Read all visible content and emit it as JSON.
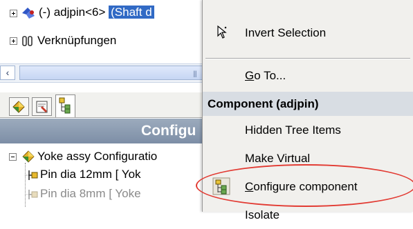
{
  "tree": {
    "top_item": {
      "prefix": "(-) adjpin<6> ",
      "selected_rest": "(Shaft d"
    },
    "verknuepfungen_label": "Verknüpfungen",
    "panel_title": "Configu",
    "config_root_label": "Yoke assy Configuratio",
    "config_children": [
      {
        "label": "Pin dia 12mm [ Yok",
        "greyed": false
      },
      {
        "label": "Pin dia 8mm [ Yoke",
        "greyed": true
      }
    ]
  },
  "context_menu": {
    "items_top": [
      {
        "label": "Invert Selection",
        "icon": "arrow-cursor-icon"
      },
      {
        "label": "Go To...",
        "underline_char": "G",
        "rest": "o To..."
      }
    ],
    "section_header": "Component (adjpin)",
    "items_bottom": [
      {
        "label": "Hidden Tree Items"
      },
      {
        "label": "Make Virtual",
        "underline_char": "k"
      },
      {
        "label": "Configure component",
        "underline_char": "C",
        "rest": "onfigure component",
        "icon": "configure-component-icon"
      },
      {
        "label": "Isolate"
      }
    ]
  },
  "colors": {
    "selection": "#316ac5",
    "annotation_ellipse": "#e23a32"
  }
}
